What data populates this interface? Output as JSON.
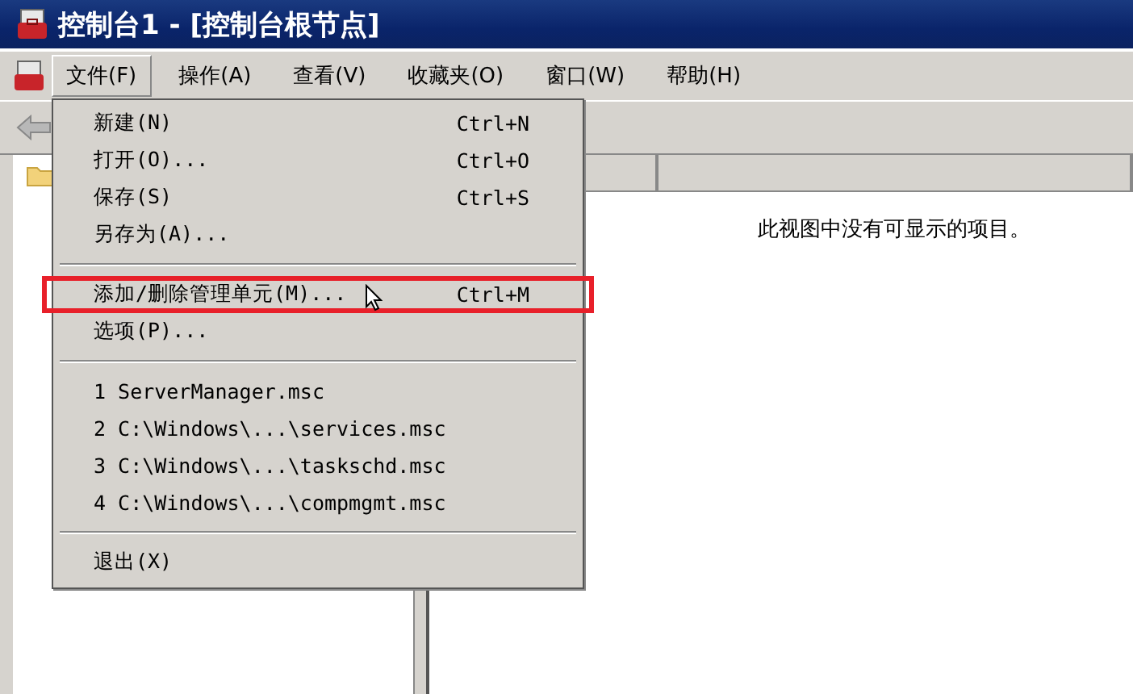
{
  "window": {
    "title": "控制台1 - [控制台根节点]"
  },
  "menu_bar": [
    {
      "label": "文件(F)",
      "selected": true
    },
    {
      "label": "操作(A)",
      "selected": false
    },
    {
      "label": "查看(V)",
      "selected": false
    },
    {
      "label": "收藏夹(O)",
      "selected": false
    },
    {
      "label": "窗口(W)",
      "selected": false
    },
    {
      "label": "帮助(H)",
      "selected": false
    }
  ],
  "file_menu": [
    {
      "kind": "item",
      "label": "新建(N)",
      "shortcut": "Ctrl+N",
      "highlighted": false
    },
    {
      "kind": "item",
      "label": "打开(O)...",
      "shortcut": "Ctrl+O",
      "highlighted": false
    },
    {
      "kind": "item",
      "label": "保存(S)",
      "shortcut": "Ctrl+S",
      "highlighted": false
    },
    {
      "kind": "item",
      "label": "另存为(A)...",
      "highlighted": false
    },
    {
      "kind": "separator"
    },
    {
      "kind": "item",
      "label": "添加/删除管理单元(M)...",
      "shortcut": "Ctrl+M",
      "highlighted": true
    },
    {
      "kind": "item",
      "label": "选项(P)...",
      "highlighted": false
    },
    {
      "kind": "separator"
    },
    {
      "kind": "item",
      "label": "1 ServerManager.msc",
      "highlighted": false
    },
    {
      "kind": "item",
      "label": "2 C:\\Windows\\...\\services.msc",
      "highlighted": false
    },
    {
      "kind": "item",
      "label": "3 C:\\Windows\\...\\taskschd.msc",
      "highlighted": false
    },
    {
      "kind": "item",
      "label": "4 C:\\Windows\\...\\compmgmt.msc",
      "highlighted": false
    },
    {
      "kind": "separator"
    },
    {
      "kind": "item",
      "label": "退出(X)",
      "highlighted": false
    }
  ],
  "result_pane": {
    "message": "此视图中没有可显示的项目。"
  }
}
